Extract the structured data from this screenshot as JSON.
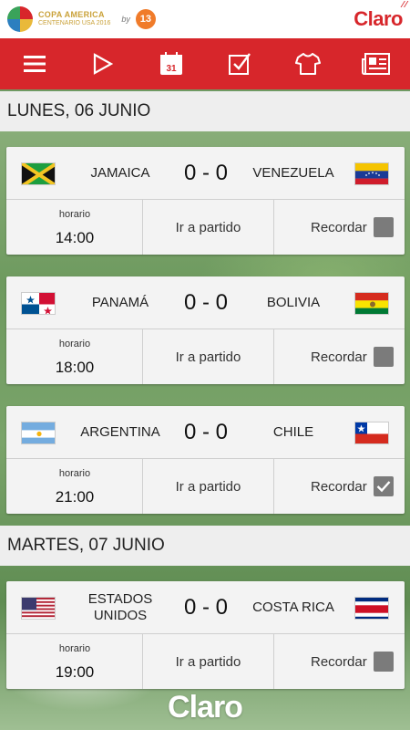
{
  "header": {
    "tournament_title": "COPA AMERICA",
    "tournament_sub": "CENTENARIO USA 2016",
    "by": "by",
    "channel": "13",
    "brand": "Claro"
  },
  "nav": {
    "icons": [
      "menu-icon",
      "play-icon",
      "calendar-icon",
      "checklist-icon",
      "shirt-icon",
      "news-icon"
    ],
    "calendar_day": "31"
  },
  "days": [
    {
      "label": "LUNES, 06 JUNIO",
      "matches": [
        {
          "home": "JAMAICA",
          "away": "VENEZUELA",
          "score": "0 - 0",
          "time_label": "horario",
          "time": "14:00",
          "go": "Ir a partido",
          "remind": "Recordar",
          "reminded": false
        },
        {
          "home": "PANAMÁ",
          "away": "BOLIVIA",
          "score": "0 - 0",
          "time_label": "horario",
          "time": "18:00",
          "go": "Ir a partido",
          "remind": "Recordar",
          "reminded": false
        },
        {
          "home": "ARGENTINA",
          "away": "CHILE",
          "score": "0 - 0",
          "time_label": "horario",
          "time": "21:00",
          "go": "Ir a partido",
          "remind": "Recordar",
          "reminded": true
        }
      ]
    },
    {
      "label": "MARTES, 07 JUNIO",
      "matches": [
        {
          "home": "ESTADOS UNIDOS",
          "away": "COSTA RICA",
          "score": "0 - 0",
          "time_label": "horario",
          "time": "19:00",
          "go": "Ir a partido",
          "remind": "Recordar",
          "reminded": false
        }
      ]
    }
  ],
  "footer": {
    "brand": "Claro"
  },
  "colors": {
    "accent": "#d7262b",
    "card": "#f3f3f3",
    "checkbox": "#7b7b7b"
  }
}
